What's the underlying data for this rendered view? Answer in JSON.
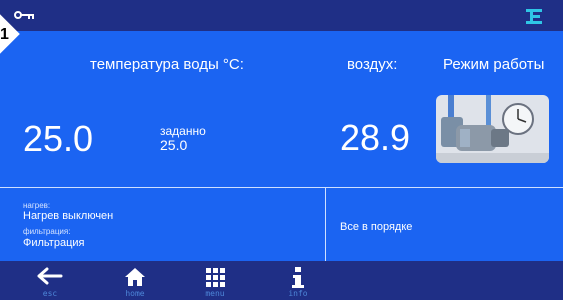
{
  "corner": {
    "digit": "1"
  },
  "topbar": {
    "left_icon": "key-icon",
    "right_icon": "logo-icon"
  },
  "main": {
    "water_header": "температура воды °C:",
    "water_value": "25.0",
    "set_label": "заданно",
    "set_value": "25.0",
    "air_header": "воздух:",
    "air_value": "28.9",
    "mode_header": "Режим работы",
    "mode_icon": "pump-filter-icon"
  },
  "bottom": {
    "heat_label": "нагрев:",
    "heat_value": "Нагрев выключен",
    "filter_label": "фильтрация:",
    "filter_value": "Фильтрация",
    "status": "Все в порядке"
  },
  "nav": {
    "esc": "esc",
    "home": "home",
    "menu": "menu",
    "info": "info"
  },
  "colors": {
    "background": "#1b64f2",
    "bars": "#1f2f86",
    "text": "#ffffff",
    "nav_label": "#4d86d8"
  }
}
